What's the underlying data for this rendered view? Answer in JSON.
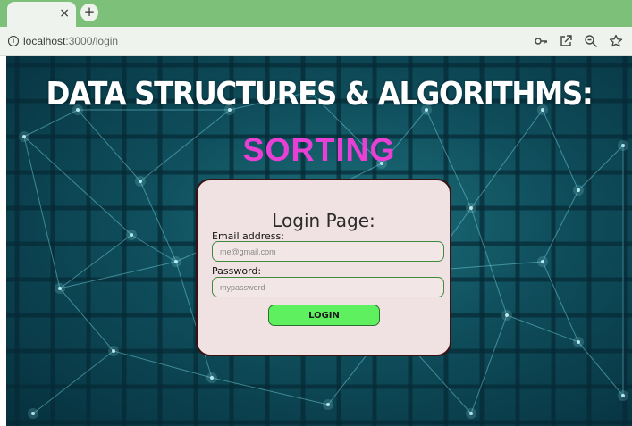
{
  "browser": {
    "tab_close": "×",
    "new_tab": "+",
    "url_host": "localhost",
    "url_path": ":3000/login",
    "icons": [
      "info-icon",
      "key-icon",
      "open-external-icon",
      "zoom-icon",
      "star-icon"
    ]
  },
  "page": {
    "title": "DATA STRUCTURES & ALGORITHMS:",
    "subtitle": "SORTING"
  },
  "login": {
    "heading": "Login Page:",
    "email_label": "Email address:",
    "email_placeholder": "me@gmail.com",
    "password_label": "Password:",
    "password_placeholder": "mypassword",
    "button_label": "LOGIN"
  },
  "colors": {
    "chrome_green": "#7cc07a",
    "subtitle_magenta": "#e83fd4",
    "button_green": "#5ef05e",
    "card_background": "#f0e2e2",
    "input_border": "#3f8a3f"
  }
}
